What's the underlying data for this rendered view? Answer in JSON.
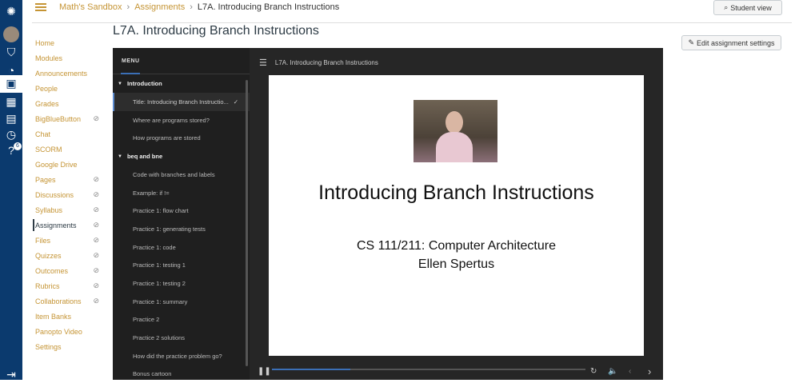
{
  "global_nav": {
    "help_badge": "6"
  },
  "breadcrumb": [
    "Math's Sandbox",
    "Assignments",
    "L7A. Introducing Branch Instructions"
  ],
  "student_view": "Student view",
  "page_title": "L7A. Introducing Branch Instructions",
  "edit_settings": "Edit assignment settings",
  "course_nav": [
    {
      "label": "Home",
      "hidden": false
    },
    {
      "label": "Modules",
      "hidden": false
    },
    {
      "label": "Announcements",
      "hidden": false
    },
    {
      "label": "People",
      "hidden": false
    },
    {
      "label": "Grades",
      "hidden": false
    },
    {
      "label": "BigBlueButton",
      "hidden": true
    },
    {
      "label": "Chat",
      "hidden": false
    },
    {
      "label": "SCORM",
      "hidden": false
    },
    {
      "label": "Google Drive",
      "hidden": false
    },
    {
      "label": "Pages",
      "hidden": true
    },
    {
      "label": "Discussions",
      "hidden": true
    },
    {
      "label": "Syllabus",
      "hidden": true
    },
    {
      "label": "Assignments",
      "hidden": true,
      "active": true
    },
    {
      "label": "Files",
      "hidden": true
    },
    {
      "label": "Quizzes",
      "hidden": true
    },
    {
      "label": "Outcomes",
      "hidden": true
    },
    {
      "label": "Rubrics",
      "hidden": true
    },
    {
      "label": "Collaborations",
      "hidden": true
    },
    {
      "label": "Item Banks",
      "hidden": false
    },
    {
      "label": "Panopto Video",
      "hidden": false
    },
    {
      "label": "Settings",
      "hidden": false
    }
  ],
  "player": {
    "menu_label": "MENU",
    "title": "L7A. Introducing Branch Instructions",
    "sections": [
      {
        "label": "Introduction",
        "items": [
          "Title: Introducing Branch Instructio...",
          "Where are programs stored?",
          "How programs are stored"
        ]
      },
      {
        "label": "beq and bne",
        "items": [
          "Code with branches and labels",
          "Example: if !=",
          "Practice 1: flow chart",
          "Practice 1: generating tests",
          "Practice 1: code",
          "Practice 1: testing 1",
          "Practice 1: testing 2",
          "Practice 1: summary",
          "Practice 2",
          "Practice 2 solutions",
          "How did the practice problem go?",
          "Bonus cartoon"
        ]
      }
    ],
    "slide": {
      "title": "Introducing Branch Instructions",
      "course": "CS 111/211: Computer Architecture",
      "author": "Ellen Spertus"
    },
    "progress_percent": 25,
    "accent": "#3b6fb6"
  },
  "colors": {
    "link": "#c59434",
    "global_nav": "#0b3a6e"
  }
}
